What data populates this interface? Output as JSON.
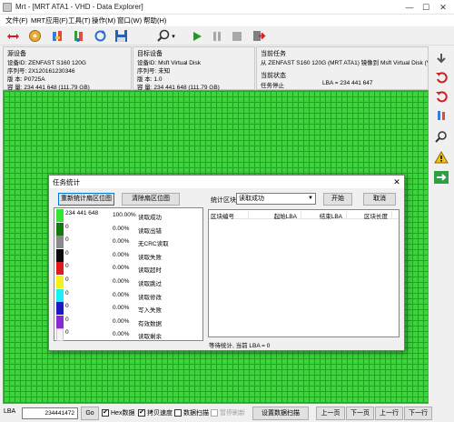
{
  "window": {
    "title": "Mrt - [MRT ATA1 - VHD - Data Explorer]",
    "controls": [
      "—",
      "☐",
      "✕"
    ]
  },
  "menu": [
    "文件(F)",
    "MRT应用(F)",
    "工具(T)",
    "操作(M)",
    "窗口(W)",
    "帮助(H)"
  ],
  "source": {
    "heading": "源设备",
    "device": "设备ID: ZENFAST S160 120G",
    "serial": "序列号: 2X120161230346",
    "version": "版    本: P0725A",
    "capacity": "容    量: 234 441 648 (111.79 GB)"
  },
  "target": {
    "heading": "目标设备",
    "device": "设备ID: Msft Virtual Disk",
    "serial": "序列号: 未知",
    "version": "版    本: 1.0",
    "capacity": "容    量: 234 441 648 (111.79 GB)"
  },
  "task": {
    "heading": "当前任务",
    "description": "从 ZENFAST S160 120G (MRT ATA1) 镜像到 Msft Virtual Disk (VHC",
    "status_heading": "当前状态",
    "status": "任务停止",
    "lba": "LBA = 234 441 647"
  },
  "dialog": {
    "title": "任务统计",
    "btn_reset": "重新统计扇区位图",
    "btn_clear": "清除扇区位图",
    "block_label": "统计区块",
    "block_select": "读取成功",
    "btn_start": "开始",
    "btn_cancel": "取消",
    "columns": [
      "区块编号",
      "起始LBA",
      "结束LBA",
      "区块长度"
    ],
    "status": "等待统计, 当前 LBA = 0",
    "legend": [
      {
        "color": "#33e633",
        "count": "234 441 648",
        "pct": "100.00%",
        "label": "读取成功"
      },
      {
        "color": "#137a13",
        "count": "0",
        "pct": "0.00%",
        "label": "读取出错"
      },
      {
        "color": "#8a8a8a",
        "count": "0",
        "pct": "0.00%",
        "label": "无CRC读取"
      },
      {
        "color": "#0a0a0a",
        "count": "0",
        "pct": "0.00%",
        "label": "读取失败"
      },
      {
        "color": "#e01818",
        "count": "0",
        "pct": "0.00%",
        "label": "读取超时"
      },
      {
        "color": "#f2f218",
        "count": "0",
        "pct": "0.00%",
        "label": "读取跳过"
      },
      {
        "color": "#18f2f2",
        "count": "0",
        "pct": "0.00%",
        "label": "读取修改"
      },
      {
        "color": "#1818c8",
        "count": "0",
        "pct": "0.00%",
        "label": "写入失败"
      },
      {
        "color": "#8a2ad6",
        "count": "0",
        "pct": "0.00%",
        "label": "有效数据"
      },
      {
        "color": "#f4f4f4",
        "count": "0",
        "pct": "0.00%",
        "label": "读取剩余"
      }
    ]
  },
  "bottom": {
    "lba_label": "LBA",
    "lba_value": "234441472",
    "go": "Go",
    "hex_label": "Hex数据",
    "hex_checked": "✔",
    "copy_speed_label": "拷贝速度",
    "copy_speed_checked": "✔",
    "data_scan_label": "数据扫描",
    "pause_refresh_label": "暂停刷新",
    "settings_button": "设置数据扫描",
    "prev_page": "上一页",
    "next_page": "下一页",
    "prev_row": "上一行",
    "next_row": "下一行"
  },
  "icons": {
    "toolbar": [
      "resize-arrows-icon",
      "disk-gold-icon",
      "tools-icon",
      "tools-icon-2",
      "refresh-icon",
      "save-icon",
      "magnifier-icon",
      "play-icon",
      "pause-icon",
      "stop-icon",
      "exit-icon"
    ],
    "sidebar": [
      "arrow-down-icon",
      "undo-icon",
      "undo-icon-2",
      "magnifier-icon",
      "warning-icon",
      "arrow-right-icon"
    ]
  }
}
